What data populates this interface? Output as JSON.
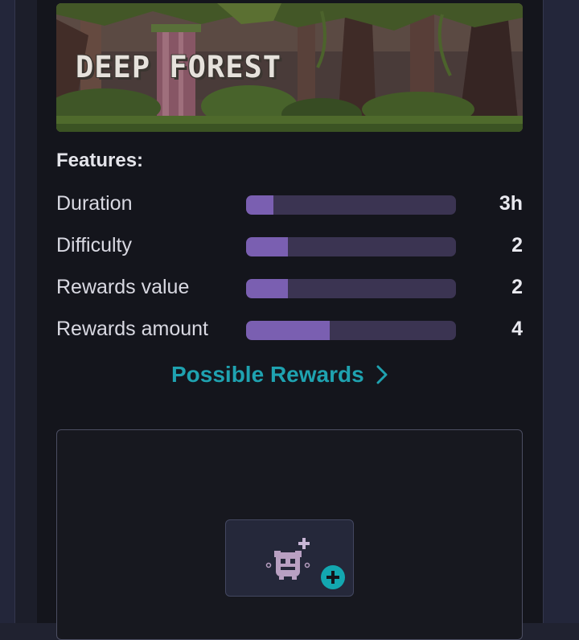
{
  "location": {
    "title": "DEEP FOREST"
  },
  "features": {
    "heading": "Features:",
    "items": [
      {
        "label": "Duration",
        "value": "3h",
        "level": 0.13
      },
      {
        "label": "Difficulty",
        "value": "2",
        "level": 0.2
      },
      {
        "label": "Rewards value",
        "value": "2",
        "level": 0.2
      },
      {
        "label": "Rewards amount",
        "value": "4",
        "level": 0.4
      }
    ]
  },
  "rewards_link": {
    "label": "Possible Rewards",
    "icon": "chevron-right-icon"
  },
  "slot": {
    "icon": "add-creature-icon",
    "badge_icon": "plus-circle-icon"
  },
  "colors": {
    "accent": "#1fa2b0",
    "bar_fill": "#7a5fb1",
    "bar_track": "#3b3452"
  }
}
